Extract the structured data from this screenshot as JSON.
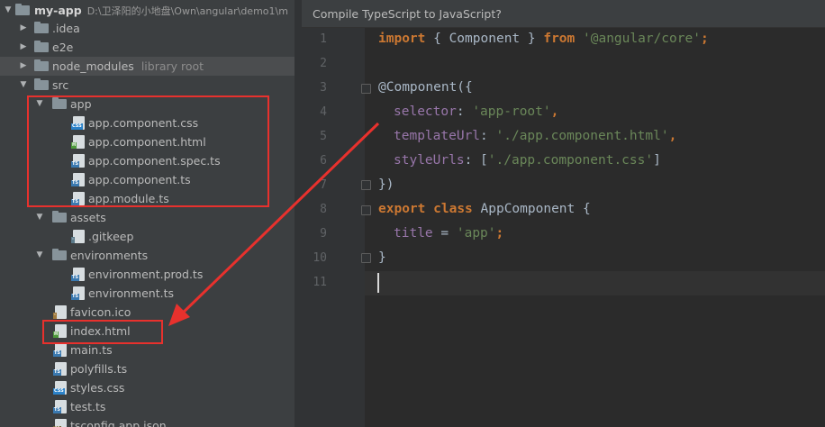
{
  "project": {
    "root": {
      "name": "my-app",
      "path": "D:\\卫泽阳的小地盘\\Own\\angular\\demo1\\m"
    },
    "items": [
      {
        "label": ".idea",
        "hint": ""
      },
      {
        "label": "e2e",
        "hint": ""
      },
      {
        "label": "node_modules",
        "hint": "library root"
      },
      {
        "label": "src",
        "hint": ""
      },
      {
        "label": "app",
        "hint": ""
      },
      {
        "label": "app.component.css",
        "hint": ""
      },
      {
        "label": "app.component.html",
        "hint": ""
      },
      {
        "label": "app.component.spec.ts",
        "hint": ""
      },
      {
        "label": "app.component.ts",
        "hint": ""
      },
      {
        "label": "app.module.ts",
        "hint": ""
      },
      {
        "label": "assets",
        "hint": ""
      },
      {
        "label": ".gitkeep",
        "hint": ""
      },
      {
        "label": "environments",
        "hint": ""
      },
      {
        "label": "environment.prod.ts",
        "hint": ""
      },
      {
        "label": "environment.ts",
        "hint": ""
      },
      {
        "label": "favicon.ico",
        "hint": ""
      },
      {
        "label": "index.html",
        "hint": ""
      },
      {
        "label": "main.ts",
        "hint": ""
      },
      {
        "label": "polyfills.ts",
        "hint": ""
      },
      {
        "label": "styles.css",
        "hint": ""
      },
      {
        "label": "test.ts",
        "hint": ""
      },
      {
        "label": "tsconfig.app.json",
        "hint": ""
      }
    ]
  },
  "editor": {
    "banner": "Compile TypeScript to JavaScript?",
    "line_numbers": [
      "1",
      "2",
      "3",
      "4",
      "5",
      "6",
      "7",
      "8",
      "9",
      "10",
      "11"
    ],
    "tokens": {
      "l1_import": "import",
      "l1_brace": " { Component } ",
      "l1_from": "from",
      "l1_sp": " ",
      "l1_str": "'@angular/core'",
      "l1_semi": ";",
      "l3": "@Component({",
      "l4_prop": "selector",
      "l4_colon": ": ",
      "l4_str": "'app-root'",
      "l4_comma": ",",
      "l5_prop": "templateUrl",
      "l5_colon": ": ",
      "l5_str": "'./app.component.html'",
      "l5_comma": ",",
      "l6_prop": "styleUrls",
      "l6_colon": ": [",
      "l6_str": "'./app.component.css'",
      "l6_close": "]",
      "l7": "})",
      "l8_export": "export",
      "l8_sp": " ",
      "l8_class": "class",
      "l8_rest": " AppComponent {",
      "l9_prop": "title",
      "l9_eq": " = ",
      "l9_str": "'app'",
      "l9_semi": ";",
      "l10": "}"
    }
  },
  "colors": {
    "keyword": "#cc7832",
    "string": "#6a8759",
    "property": "#9876aa",
    "annotation_red": "#e8312d"
  },
  "icons": {
    "folder": "folder-icon",
    "css": "css-file-icon",
    "html": "html-file-icon",
    "ts": "typescript-file-icon"
  }
}
